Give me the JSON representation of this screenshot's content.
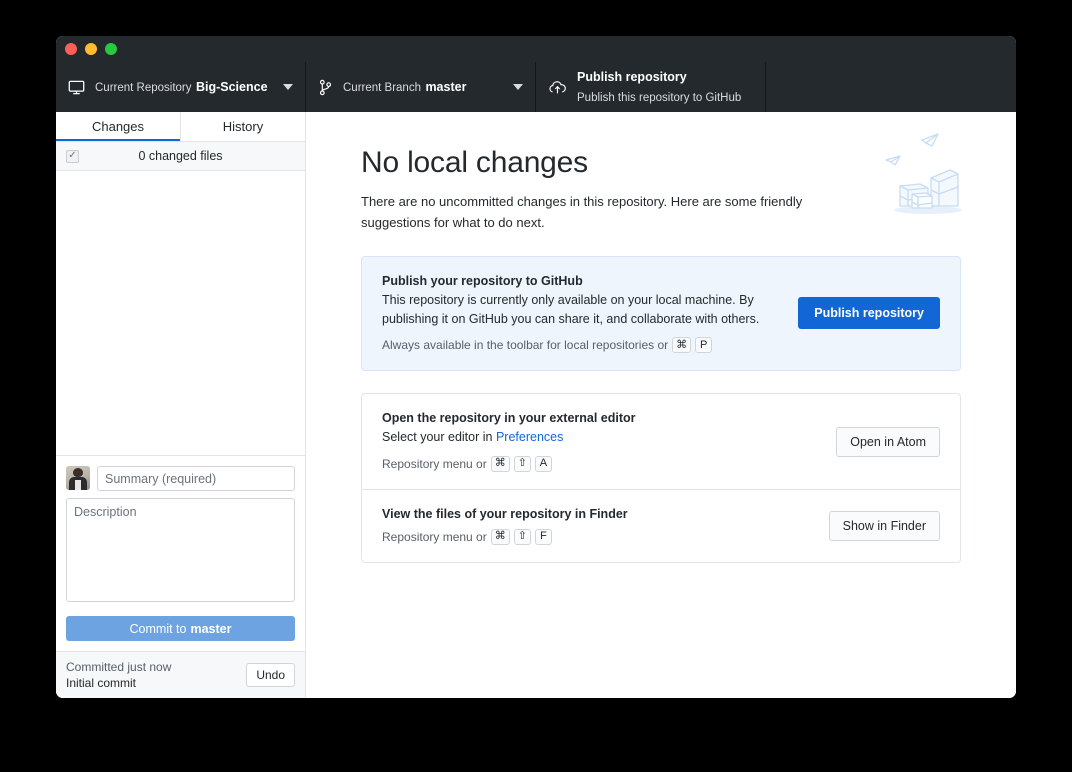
{
  "window": {
    "traffic_lights": [
      "close",
      "minimize",
      "zoom"
    ],
    "colors": {
      "toolbar_bg": "#24292e",
      "accent_blue": "#1366d6",
      "commit_button": "#6ca3e0",
      "link": "#1366d6",
      "highlight_card_bg": "#eef5fd"
    }
  },
  "toolbar": {
    "repository": {
      "label": "Current Repository",
      "value": "Big-Science",
      "icon": "desktop-icon"
    },
    "branch": {
      "label": "Current Branch",
      "value": "master",
      "icon": "branch-icon"
    },
    "publish": {
      "title": "Publish repository",
      "subtitle": "Publish this repository to GitHub",
      "icon": "cloud-upload-icon"
    }
  },
  "sidebar": {
    "tabs": [
      {
        "label": "Changes",
        "active": true
      },
      {
        "label": "History",
        "active": false
      }
    ],
    "changed_files": {
      "text": "0 changed files",
      "checkbox_checked": true,
      "check_glyph": "✓"
    },
    "commit_form": {
      "summary_placeholder": "Summary (required)",
      "summary_value": "",
      "description_placeholder": "Description",
      "description_value": "",
      "commit_button_prefix": "Commit to ",
      "commit_button_branch": "master"
    },
    "status": {
      "line1": "Committed just now",
      "line2": "Initial commit",
      "undo_label": "Undo"
    }
  },
  "main": {
    "heading": "No local changes",
    "subtext": "There are no uncommitted changes in this repository. Here are some friendly suggestions for what to do next.",
    "illustration": "boxes-and-paper-planes-illustration",
    "suggestions": [
      {
        "title": "Publish your repository to GitHub",
        "desc": "This repository is currently only available on your local machine. By publishing it on GitHub you can share it, and collaborate with others.",
        "hint_prefix": "Always available in the toolbar for local repositories or",
        "keys": [
          "⌘",
          "P"
        ],
        "button": "Publish repository",
        "button_style": "primary",
        "highlight": true
      },
      {
        "title": "Open the repository in your external editor",
        "desc_prefix": "Select your editor in ",
        "desc_link": "Preferences",
        "hint_prefix": "Repository menu or",
        "keys": [
          "⌘",
          "⇧",
          "A"
        ],
        "button": "Open in Atom",
        "button_style": "default",
        "highlight": false
      },
      {
        "title": "View the files of your repository in Finder",
        "hint_prefix": "Repository menu or",
        "keys": [
          "⌘",
          "⇧",
          "F"
        ],
        "button": "Show in Finder",
        "button_style": "default",
        "highlight": false
      }
    ]
  }
}
